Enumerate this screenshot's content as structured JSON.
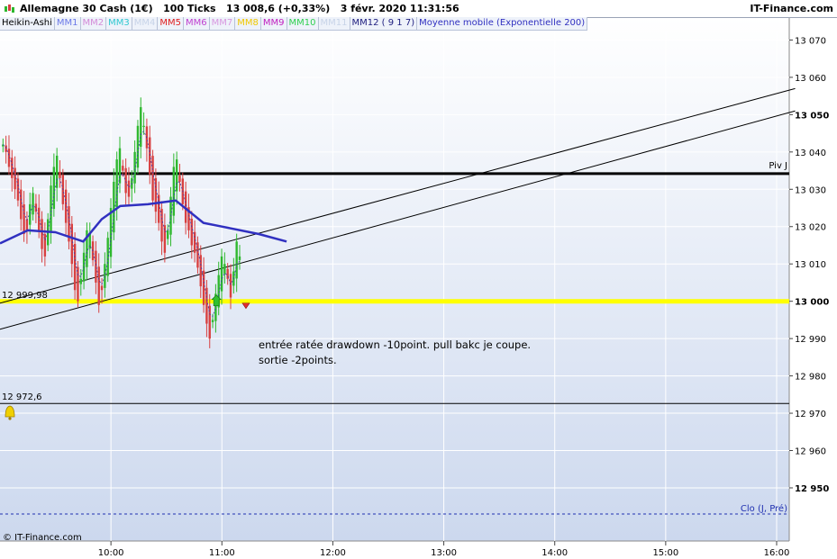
{
  "window": {
    "title": "Allemagne 30 Cash (1€)   100 Ticks   13 008,6 (+0,33%)   3 févr. 2020 11:31:56",
    "brand": "IT-Finance.com"
  },
  "legend": [
    {
      "label": "Heikin-Ashi",
      "color": "#000000"
    },
    {
      "label": "MM1",
      "color": "#6a78e8"
    },
    {
      "label": "MM2",
      "color": "#d48ad8"
    },
    {
      "label": "MM3",
      "color": "#30c8d0"
    },
    {
      "label": "MM4",
      "color": "#c8d4e8"
    },
    {
      "label": "MM5",
      "color": "#e02020"
    },
    {
      "label": "MM6",
      "color": "#c040d0"
    },
    {
      "label": "MM7",
      "color": "#d898e0"
    },
    {
      "label": "MM8",
      "color": "#f0c800"
    },
    {
      "label": "MM9",
      "color": "#c020c0"
    },
    {
      "label": "MM10",
      "color": "#30d050"
    },
    {
      "label": "MM11",
      "color": "#c8d4e8"
    },
    {
      "label": "MM12 ( 9 1 7)",
      "color": "#202080"
    },
    {
      "label": "Moyenne mobile (Exponentielle 200)",
      "color": "#3030c0"
    }
  ],
  "levels": {
    "support": {
      "label": "12 999,98",
      "value": 12999.98,
      "color": "#ffff00"
    },
    "alert": {
      "label": "12 972,6",
      "value": 12972.6
    },
    "pivot": {
      "label": "Piv J",
      "value": 13034.2
    },
    "prev_close": {
      "label": "Clo (J, Pré)",
      "value": 12943
    }
  },
  "annotation": {
    "line1": "entrée ratée drawdown -10point. pull bakc  je coupe.",
    "line2": "sortie -2points."
  },
  "copyright": "© IT-Finance.com",
  "chart_data": {
    "type": "candlestick",
    "instrument": "Allemagne 30 Cash (1€)",
    "ylim": [
      12934,
      13078
    ],
    "y_ticks": [
      "13 070",
      "13 060",
      "13 050",
      "13 040",
      "13 030",
      "13 020",
      "13 010",
      "13 000",
      "12 990",
      "12 980",
      "12 970",
      "12 960",
      "12 950"
    ],
    "y_tick_values": [
      13070,
      13060,
      13050,
      13040,
      13030,
      13020,
      13010,
      13000,
      12990,
      12980,
      12970,
      12960,
      12950
    ],
    "bold_ticks": [
      "13 050",
      "13 000",
      "12 950"
    ],
    "x_ticks": [
      "10:00",
      "11:00",
      "12:00",
      "13:00",
      "14:00",
      "15:00",
      "16:00"
    ],
    "x_tick_hours": [
      10,
      11,
      12,
      13,
      14,
      15,
      16
    ],
    "x_start_hour": 9.027,
    "bar_interval_hours": 0.009,
    "candle_colors": {
      "up": "#2eb82e",
      "down": "#d84040"
    },
    "closes": [
      13042,
      13040,
      13036,
      13033,
      13030,
      13027,
      13022,
      13018,
      13019,
      13026,
      13029,
      13024,
      13019,
      13014,
      13012,
      13022,
      13031,
      13036,
      13039,
      13033,
      13026,
      13021,
      13016,
      13010,
      13003,
      13000,
      13006,
      13013,
      13019,
      13018,
      13011,
      13005,
      12999,
      13003,
      13010,
      13017,
      13025,
      13032,
      13038,
      13041,
      13035,
      13029,
      13028,
      13033,
      13040,
      13047,
      13052,
      13047,
      13041,
      13034,
      13027,
      13024,
      13021,
      13016,
      13013,
      13019,
      13028,
      13036,
      13038,
      13032,
      13026,
      13021,
      13019,
      13015,
      13013,
      13009,
      13004,
      12999,
      12994,
      12990,
      12995,
      13002,
      13007,
      13012,
      13010,
      13006,
      13001,
      13008,
      13016,
      13012
    ],
    "resistance_lines": [
      {
        "from": [
          "09:00",
          12999.5
        ],
        "to": [
          "16:10",
          13057
        ]
      },
      {
        "from": [
          "09:00",
          12992.5
        ],
        "to": [
          "16:10",
          13051
        ]
      }
    ],
    "ema200": [
      [
        "09:00",
        13015.5
      ],
      [
        "09:15",
        13019
      ],
      [
        "09:30",
        13018.5
      ],
      [
        "09:45",
        13016
      ],
      [
        "09:55",
        13022
      ],
      [
        "10:05",
        13025.5
      ],
      [
        "10:20",
        13026
      ],
      [
        "10:35",
        13027
      ],
      [
        "10:50",
        13021
      ],
      [
        "11:00",
        13020
      ],
      [
        "11:20",
        13018
      ],
      [
        "11:35",
        13016
      ]
    ]
  }
}
